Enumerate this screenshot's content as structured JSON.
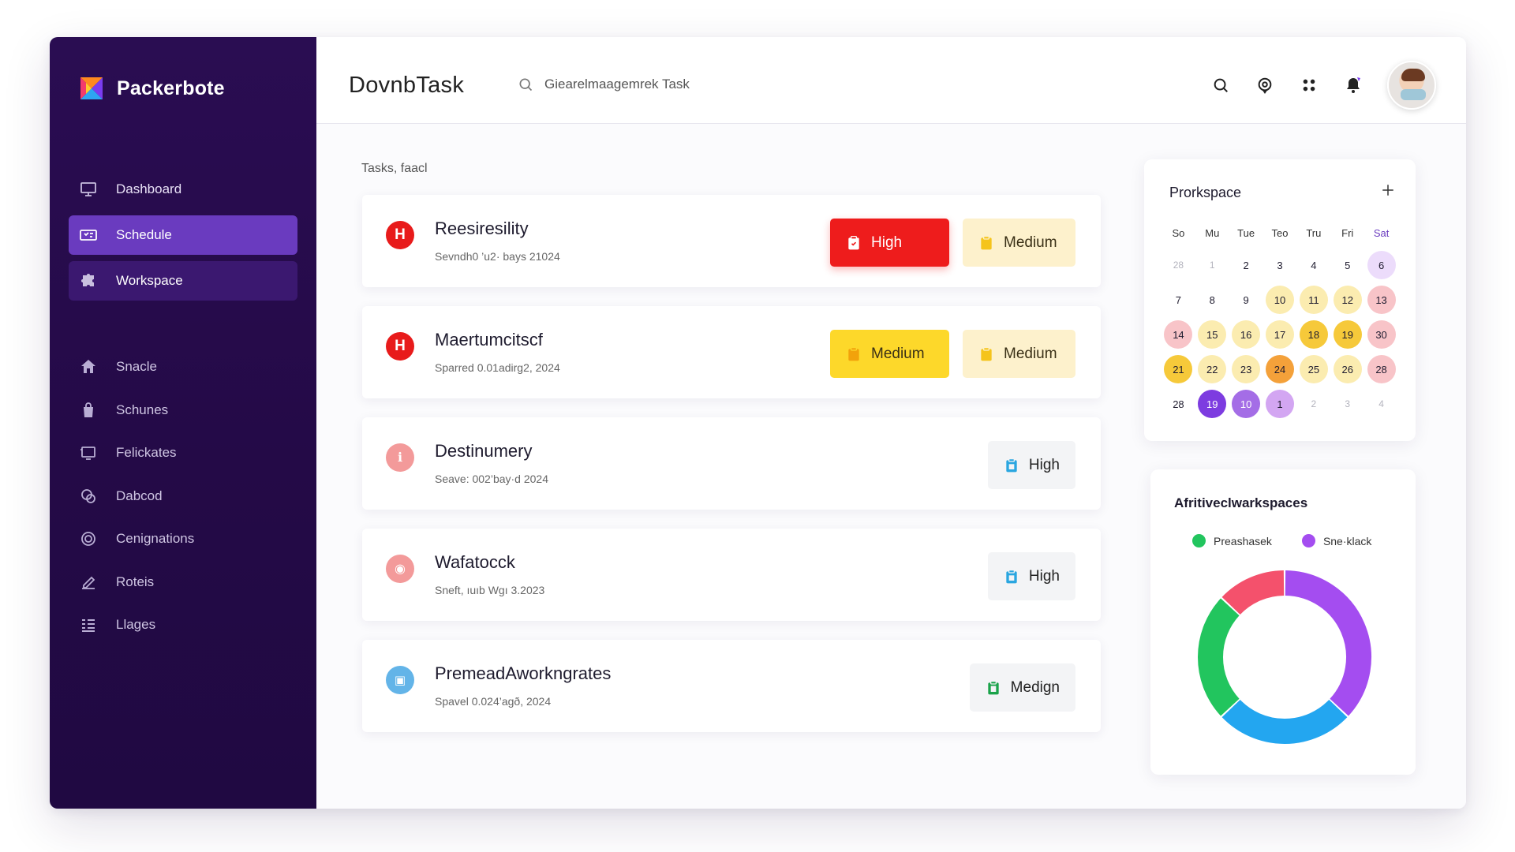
{
  "brand": {
    "name": "Packerbote"
  },
  "sidebar": {
    "primary": [
      {
        "label": "Dashboard",
        "icon": "monitor-icon",
        "state": "normal"
      },
      {
        "label": "Schedule",
        "icon": "ticket-icon",
        "state": "active"
      },
      {
        "label": "Workspace",
        "icon": "puzzle-icon",
        "state": "soft"
      }
    ],
    "secondary": [
      {
        "label": "Snacle",
        "icon": "home-icon"
      },
      {
        "label": "Schunes",
        "icon": "bag-icon"
      },
      {
        "label": "Felickates",
        "icon": "screen-icon"
      },
      {
        "label": "Dabcod",
        "icon": "chat-icon"
      },
      {
        "label": "Cenignations",
        "icon": "target-icon"
      },
      {
        "label": "Roteis",
        "icon": "edit-icon"
      },
      {
        "label": "Llages",
        "icon": "list-icon"
      }
    ]
  },
  "header": {
    "title": "DovnbTask",
    "search_text": "Giearelmaagemrek Task"
  },
  "main": {
    "section_label": "Tasks, faacl",
    "tasks": [
      {
        "title": "Reesiresility",
        "subtitle": "Sevndh0 ’u2· bays 21024",
        "icon_color": "#e81b1b",
        "icon_glyph": "H",
        "badges": [
          {
            "label": "High",
            "style": "high-red"
          },
          {
            "label": "Medium",
            "style": "med-pale"
          }
        ]
      },
      {
        "title": "Maertumcitscf",
        "subtitle": "Sparred 0.01adirg2, 2024",
        "icon_color": "#e81b1b",
        "icon_glyph": "H",
        "badges": [
          {
            "label": "Medium",
            "style": "med-yellow"
          },
          {
            "label": "Medium",
            "style": "med-pale"
          }
        ]
      },
      {
        "title": "Destinumery",
        "subtitle": "Seave: 002’bay·d 2024",
        "icon_color": "#f39a9a",
        "icon_glyph": "ℹ",
        "badges": [
          {
            "label": "High",
            "style": "high-gray"
          }
        ]
      },
      {
        "title": "Wafatocck",
        "subtitle": "Sneft, ıuıb Wgı 3.2023",
        "icon_color": "#f39a9a",
        "icon_glyph": "◉",
        "badges": [
          {
            "label": "High",
            "style": "high-gray"
          }
        ]
      },
      {
        "title": "PremeadAworkngrates",
        "subtitle": "Spavel 0.024’agð, 2024",
        "icon_color": "#63b4e8",
        "icon_glyph": "▣",
        "badges": [
          {
            "label": "Medign",
            "style": "medign"
          }
        ]
      }
    ]
  },
  "calendar": {
    "title": "Prorkspace",
    "weekdays": [
      "So",
      "Mu",
      "Tue",
      "Teo",
      "Tru",
      "Fri",
      "Sat"
    ],
    "cells": [
      {
        "d": "28",
        "s": "muted"
      },
      {
        "d": "1",
        "s": "muted"
      },
      {
        "d": "2",
        "s": ""
      },
      {
        "d": "3",
        "s": ""
      },
      {
        "d": "4",
        "s": ""
      },
      {
        "d": "5",
        "s": ""
      },
      {
        "d": "6",
        "s": "lilac"
      },
      {
        "d": "7",
        "s": ""
      },
      {
        "d": "8",
        "s": ""
      },
      {
        "d": "9",
        "s": ""
      },
      {
        "d": "10",
        "s": "yellow"
      },
      {
        "d": "11",
        "s": "yellow"
      },
      {
        "d": "12",
        "s": "yellow"
      },
      {
        "d": "13",
        "s": "pink"
      },
      {
        "d": "14",
        "s": "pink"
      },
      {
        "d": "15",
        "s": "yellow"
      },
      {
        "d": "16",
        "s": "yellow"
      },
      {
        "d": "17",
        "s": "yellow"
      },
      {
        "d": "18",
        "s": "gold"
      },
      {
        "d": "19",
        "s": "gold"
      },
      {
        "d": "30",
        "s": "pink"
      },
      {
        "d": "21",
        "s": "gold"
      },
      {
        "d": "22",
        "s": "yellow"
      },
      {
        "d": "23",
        "s": "yellow"
      },
      {
        "d": "24",
        "s": "orange"
      },
      {
        "d": "25",
        "s": "yellow"
      },
      {
        "d": "26",
        "s": "yellow"
      },
      {
        "d": "28",
        "s": "pink"
      },
      {
        "d": "28",
        "s": ""
      },
      {
        "d": "19",
        "s": "purple"
      },
      {
        "d": "10",
        "s": "violet"
      },
      {
        "d": "1",
        "s": "lavender"
      },
      {
        "d": "2",
        "s": "muted"
      },
      {
        "d": "3",
        "s": "muted"
      },
      {
        "d": "4",
        "s": "muted"
      }
    ]
  },
  "chart_data": {
    "type": "pie",
    "title": "Afritiveclwarkspaces",
    "legend": [
      {
        "name": "Preashasek",
        "color": "#22c55e"
      },
      {
        "name": "Sne·klack",
        "color": "#a44df0"
      }
    ],
    "segments": [
      {
        "value": 37,
        "color": "#a44df0"
      },
      {
        "value": 26,
        "color": "#23a6f0"
      },
      {
        "value": 24,
        "color": "#22c55e"
      },
      {
        "value": 13,
        "color": "#f4516c"
      }
    ]
  },
  "colors": {
    "sidebar_bg": "#240a47",
    "accent": "#6a3bbf",
    "high": "#ee1c1c",
    "medium": "#fdd82a"
  }
}
